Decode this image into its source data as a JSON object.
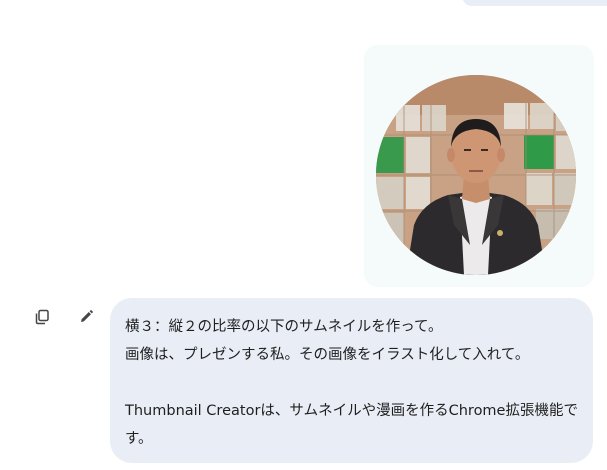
{
  "conversation": {
    "attachment": {
      "kind": "uploaded-photo",
      "subject": "portrait"
    },
    "actions": {
      "copy_icon": "copy-icon",
      "edit_icon": "edit-pencil-icon"
    },
    "prompt": {
      "line1": "横３：縦２の比率の以下のサムネイルを作って。",
      "line2": "画像は、プレゼンする私。その画像をイラスト化して入れて。",
      "line3": "Thumbnail Creatorは、サムネイルや漫画を作るChrome拡張機能です。"
    }
  },
  "colors": {
    "page_bg": "#ffffff",
    "user_bubble_bg": "#e9eef6",
    "image_card_bg": "#f4fbfa",
    "text": "#1f1f1f",
    "icon": "#444746"
  }
}
